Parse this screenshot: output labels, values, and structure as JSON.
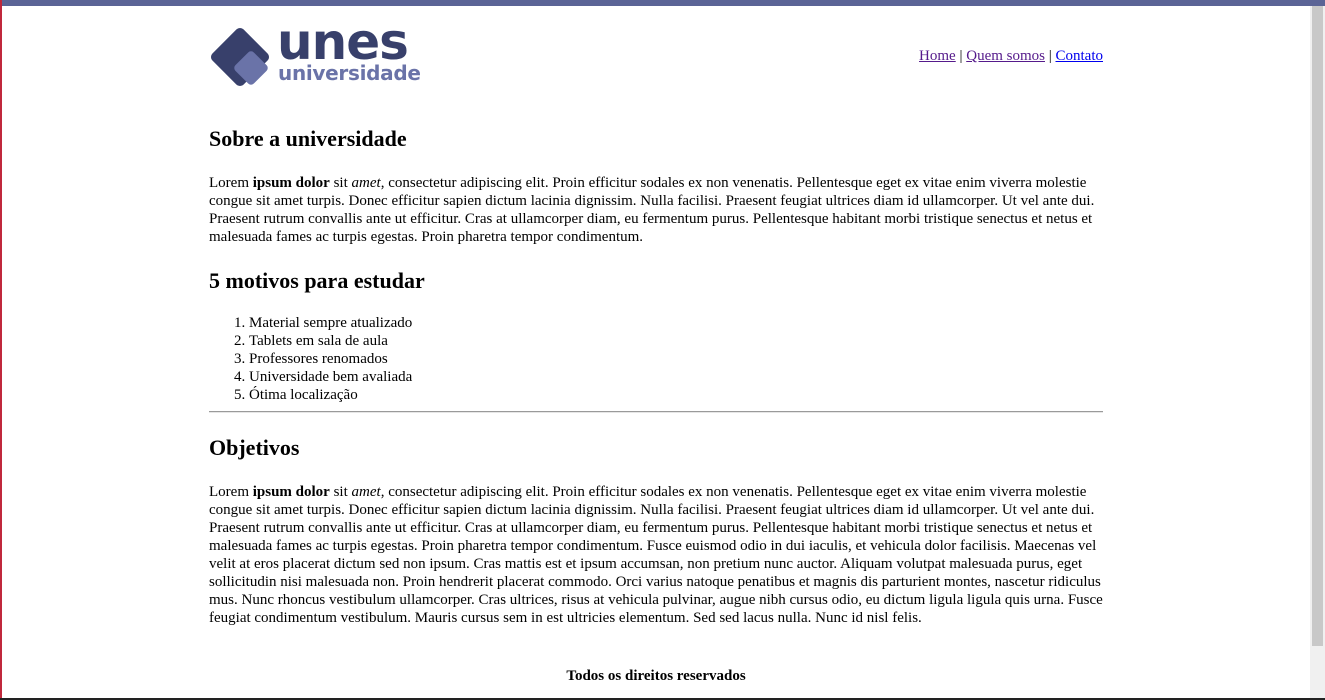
{
  "logo": {
    "name": "unes",
    "subtitle": "universidade",
    "colors": {
      "dark": "#38406b",
      "light": "#6a73a8"
    }
  },
  "nav": {
    "items": [
      {
        "label": "Home",
        "state": "visited"
      },
      {
        "label": "Quem somos",
        "state": "visited"
      },
      {
        "label": "Contato",
        "state": "link"
      }
    ],
    "separator": "|"
  },
  "about": {
    "title": "Sobre a universidade",
    "parts": {
      "p1": "Lorem ",
      "b1": "ipsum dolor",
      "p2": " sit ",
      "i1": "amet",
      "p3": ", consectetur adipiscing elit. Proin efficitur sodales ex non venenatis. Pellentesque eget ex vitae enim viverra molestie congue sit amet turpis. Donec efficitur sapien dictum lacinia dignissim. Nulla facilisi. Praesent feugiat ultrices diam id ullamcorper. Ut vel ante dui. Praesent rutrum convallis ante ut efficitur. Cras at ullamcorper diam, eu fermentum purus. Pellentesque habitant morbi tristique senectus et netus et malesuada fames ac turpis egestas. Proin pharetra tempor condimentum."
    }
  },
  "reasons": {
    "title": "5 motivos para estudar",
    "items": [
      "Material sempre atualizado",
      "Tablets em sala de aula",
      "Professores renomados",
      "Universidade bem avaliada",
      "Ótima localização"
    ]
  },
  "objectives": {
    "title": "Objetivos",
    "parts": {
      "p1": "Lorem ",
      "b1": "ipsum dolor",
      "p2": " sit ",
      "i1": "amet",
      "p3": ", consectetur adipiscing elit. Proin efficitur sodales ex non venenatis. Pellentesque eget ex vitae enim viverra molestie congue sit amet turpis. Donec efficitur sapien dictum lacinia dignissim. Nulla facilisi. Praesent feugiat ultrices diam id ullamcorper. Ut vel ante dui. Praesent rutrum convallis ante ut efficitur. Cras at ullamcorper diam, eu fermentum purus. Pellentesque habitant morbi tristique senectus et netus et malesuada fames ac turpis egestas. Proin pharetra tempor condimentum. Fusce euismod odio in dui iaculis, et vehicula dolor facilisis. Maecenas vel velit at eros placerat dictum sed non ipsum. Cras mattis est et ipsum accumsan, non pretium nunc auctor. Aliquam volutpat malesuada purus, eget sollicitudin nisi malesuada non. Proin hendrerit placerat commodo. Orci varius natoque penatibus et magnis dis parturient montes, nascetur ridiculus mus. Nunc rhoncus vestibulum ullamcorper. Cras ultrices, risus at vehicula pulvinar, augue nibh cursus odio, eu dictum ligula ligula quis urna. Fusce feugiat condimentum vestibulum. Mauris cursus sem in est ultricies elementum. Sed sed lacus nulla. Nunc id nisl felis."
    }
  },
  "footer": {
    "text": "Todos os direitos reservados"
  }
}
